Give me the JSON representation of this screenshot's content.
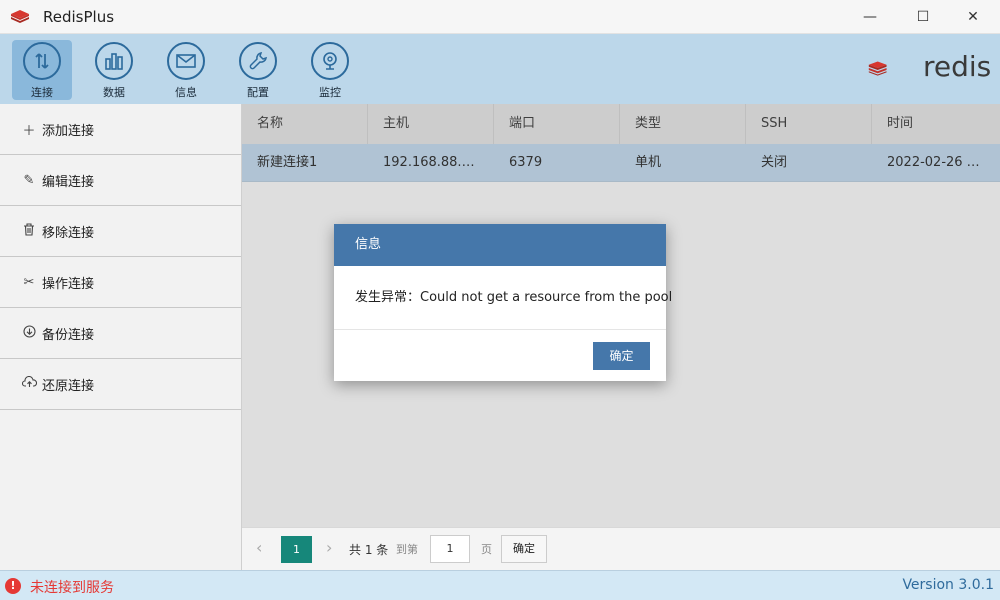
{
  "window": {
    "title": "RedisPlus"
  },
  "toolbar": {
    "items": [
      {
        "label": "连接",
        "icon": "swap-arrows-icon",
        "active": true
      },
      {
        "label": "数据",
        "icon": "bar-chart-icon"
      },
      {
        "label": "信息",
        "icon": "envelope-icon"
      },
      {
        "label": "配置",
        "icon": "wrench-icon"
      },
      {
        "label": "监控",
        "icon": "webcam-icon"
      }
    ],
    "brand": "redis"
  },
  "sidebar": {
    "items": [
      {
        "label": "添加连接",
        "icon": "plus-icon"
      },
      {
        "label": "编辑连接",
        "icon": "pencil-icon"
      },
      {
        "label": "移除连接",
        "icon": "trash-icon"
      },
      {
        "label": "操作连接",
        "icon": "tools-icon"
      },
      {
        "label": "备份连接",
        "icon": "download-circle-icon"
      },
      {
        "label": "还原连接",
        "icon": "cloud-upload-icon"
      }
    ]
  },
  "table": {
    "columns": [
      "名称",
      "主机",
      "端口",
      "类型",
      "SSH",
      "时间"
    ],
    "rows": [
      [
        "新建连接1",
        "192.168.88.…",
        "6379",
        "单机",
        "关闭",
        "2022-02-26 …"
      ]
    ]
  },
  "pager": {
    "current": "1",
    "total": "共 1 条",
    "goto_label": "到第",
    "input_value": "1",
    "page_label": "页",
    "ok_label": "确定"
  },
  "dialog": {
    "title": "信息",
    "message": "发生异常：Could not get a resource from the pool",
    "ok_label": "确定"
  },
  "status": {
    "message": "未连接到服务",
    "version": "Version 3.0.1"
  },
  "colors": {
    "accent": "#4577aa",
    "toolbar_bg": "#bcd7ea",
    "pager_active": "#16877a",
    "error": "#e53935"
  }
}
